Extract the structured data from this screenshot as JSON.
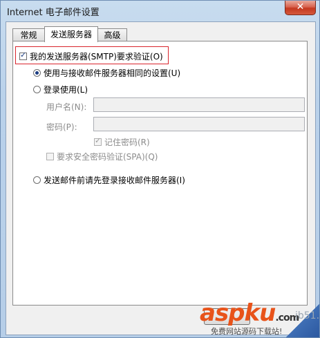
{
  "window": {
    "title": "Internet 电子邮件设置",
    "close_label": "✕"
  },
  "tabs": [
    {
      "label": "常规"
    },
    {
      "label": "发送服务器"
    },
    {
      "label": "高级"
    }
  ],
  "panel": {
    "smtp_auth_label": "我的发送服务器(SMTP)要求验证(O)",
    "smtp_auth_checked": true,
    "same_settings_label": "使用与接收邮件服务器相同的设置(U)",
    "login_using_label": "登录使用(L)",
    "username_label": "用户名(N):",
    "username_value": "",
    "password_label": "密码(P):",
    "password_value": "",
    "remember_password_label": "记住密码(R)",
    "spa_label": "要求安全密码验证(SPA)(Q)",
    "login_before_send_label": "发送邮件前请先登录接收邮件服务器(I)"
  },
  "watermark": {
    "brand": "aspku",
    "brand_suffix": ".com",
    "subtitle": "免费网站源码下载站!",
    "gray_text": "jb51.net"
  },
  "colors": {
    "highlight": "#d9232b",
    "brand": "#e8531a"
  }
}
